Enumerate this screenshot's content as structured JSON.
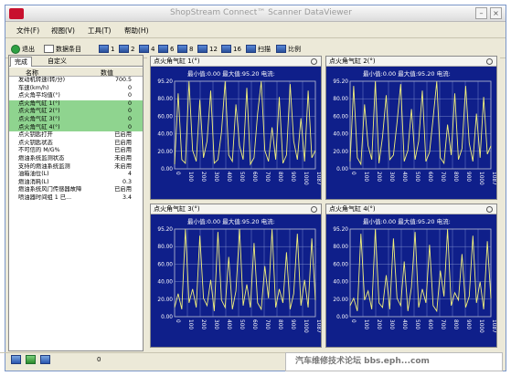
{
  "window": {
    "title": "ShopStream Connect™ Scanner DataViewer"
  },
  "menu": [
    "文件(F)",
    "视图(V)",
    "工具(T)",
    "帮助(H)"
  ],
  "toolbar": {
    "exit": "退出",
    "params": "数据条目",
    "b1": "1",
    "b2": "2",
    "b4": "4",
    "b6": "6",
    "b8": "8",
    "b12": "12",
    "b16": "16",
    "scan": "扫描",
    "ratio": "比例"
  },
  "tabs": {
    "done": "完成",
    "custom": "自定义"
  },
  "table": {
    "col_name": "名称",
    "col_value": "数值",
    "rows": [
      {
        "name": "发动机转速(转/分)",
        "value": "700.5",
        "hl": false
      },
      {
        "name": "车速(km/h)",
        "value": "0",
        "hl": false
      },
      {
        "name": "点火角平均值(°)",
        "value": "0",
        "hl": false
      },
      {
        "name": "点火角气缸 1(°)",
        "value": "0",
        "hl": true
      },
      {
        "name": "点火角气缸 2(°)",
        "value": "0",
        "hl": true
      },
      {
        "name": "点火角气缸 3(°)",
        "value": "0",
        "hl": true
      },
      {
        "name": "点火角气缸 4(°)",
        "value": "0",
        "hl": true
      },
      {
        "name": "点火钥匙打开",
        "value": "已启用",
        "hl": false
      },
      {
        "name": "点火钥匙状态",
        "value": "已启用",
        "hl": false
      },
      {
        "name": "不可信的 M/G%",
        "value": "已启用",
        "hl": false
      },
      {
        "name": "燃油系统监测状态",
        "value": "未启用",
        "hl": false
      },
      {
        "name": "支持的燃油系统监测",
        "value": "未启用",
        "hl": false
      },
      {
        "name": "油箱油位(L)",
        "value": "4",
        "hl": false
      },
      {
        "name": "燃油消耗(L)",
        "value": "0.3",
        "hl": false
      },
      {
        "name": "燃油系统风门传感器故障",
        "value": "已启用",
        "hl": false
      },
      {
        "name": "喷油器时间组 1 已...",
        "value": "3.4",
        "hl": false
      }
    ]
  },
  "panels": [
    {
      "title": "点火角气缸 1(°)",
      "stats": "最小值:0.00    最大值:95.20    电流:"
    },
    {
      "title": "点火角气缸 2(°)",
      "stats": "最小值:0.00    最大值:95.20    电流:"
    },
    {
      "title": "点火角气缸 3(°)",
      "stats": "最小值:0.00    最大值:95.20    电流:"
    },
    {
      "title": "点火角气缸 4(°)",
      "stats": "最小值:0.00    最大值:95.20    电流:"
    }
  ],
  "chart_data": [
    {
      "type": "line",
      "series": [
        {
          "values": [
            5,
            82,
            10,
            6,
            95,
            20,
            8,
            75,
            12,
            30,
            85,
            6,
            10,
            40,
            95,
            15,
            8,
            70,
            25,
            10,
            88,
            5,
            12,
            60,
            95,
            20,
            8,
            45,
            10,
            78,
            6,
            15,
            92,
            30,
            10,
            55,
            8,
            85,
            12,
            20
          ]
        }
      ],
      "yticks": [
        "95.20",
        "80.00",
        "60.00",
        "40.00",
        "20.00",
        "0.00"
      ],
      "xticks": [
        "0",
        "100",
        "200",
        "300",
        "400",
        "500",
        "600",
        "700",
        "800",
        "900",
        "1000",
        "1087"
      ]
    },
    {
      "type": "line",
      "series": [
        {
          "values": [
            8,
            90,
            12,
            5,
            70,
            25,
            10,
            95,
            6,
            35,
            80,
            10,
            15,
            50,
            92,
            8,
            20,
            65,
            10,
            30,
            85,
            8,
            18,
            55,
            95,
            12,
            6,
            48,
            15,
            82,
            10,
            22,
            90,
            28,
            8,
            60,
            12,
            78,
            16,
            25
          ]
        }
      ],
      "yticks": [
        "95.20",
        "80.00",
        "60.00",
        "40.00",
        "20.00",
        "0.00"
      ],
      "xticks": [
        "0",
        "100",
        "200",
        "300",
        "400",
        "500",
        "600",
        "700",
        "800",
        "900",
        "1000",
        "1087"
      ]
    },
    {
      "type": "line",
      "series": [
        {
          "values": [
            10,
            25,
            8,
            95,
            15,
            30,
            10,
            88,
            20,
            12,
            40,
            6,
            92,
            18,
            10,
            65,
            8,
            28,
            95,
            12,
            35,
            10,
            80,
            15,
            8,
            55,
            20,
            95,
            10,
            30,
            15,
            70,
            8,
            25,
            90,
            12,
            40,
            10,
            85,
            18
          ]
        }
      ],
      "yticks": [
        "95.20",
        "80.00",
        "60.00",
        "40.00",
        "20.00",
        "0.00"
      ],
      "xticks": [
        "0",
        "100",
        "200",
        "300",
        "400",
        "500",
        "600",
        "700",
        "800",
        "900",
        "1000",
        "1087"
      ]
    },
    {
      "type": "line",
      "series": [
        {
          "values": [
            12,
            20,
            6,
            90,
            18,
            28,
            8,
            95,
            15,
            10,
            45,
            8,
            85,
            20,
            12,
            60,
            6,
            32,
            92,
            10,
            30,
            15,
            78,
            12,
            6,
            50,
            22,
            95,
            12,
            26,
            18,
            68,
            10,
            22,
            88,
            15,
            38,
            8,
            82,
            20
          ]
        }
      ],
      "yticks": [
        "95.20",
        "80.00",
        "60.00",
        "40.00",
        "20.00",
        "0.00"
      ],
      "xticks": [
        "0",
        "100",
        "200",
        "300",
        "400",
        "500",
        "600",
        "700",
        "800",
        "900",
        "1000",
        "1087"
      ]
    }
  ],
  "status": {
    "count": "0"
  },
  "watermark": "汽车维修技术论坛 bbs.eph...com"
}
